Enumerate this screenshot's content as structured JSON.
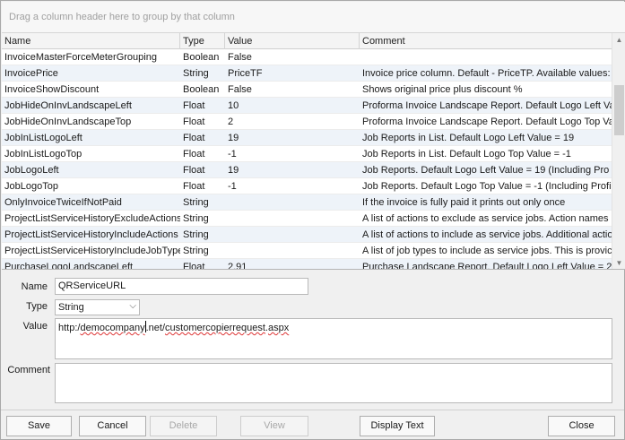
{
  "group_panel": {
    "hint": "Drag a column header here to group by that column"
  },
  "grid": {
    "columns": [
      "Name",
      "Type",
      "Value",
      "Comment"
    ],
    "rows": [
      {
        "name": "InvoiceMasterForceMeterGrouping",
        "type": "Boolean",
        "value": "False",
        "comment": ""
      },
      {
        "name": "InvoicePrice",
        "type": "String",
        "value": "PriceTF",
        "comment": "Invoice price column. Default - PriceTP. Available values:"
      },
      {
        "name": "InvoiceShowDiscount",
        "type": "Boolean",
        "value": "False",
        "comment": "Shows original price plus discount %"
      },
      {
        "name": "JobHideOnInvLandscapeLeft",
        "type": "Float",
        "value": "10",
        "comment": "Proforma Invoice Landscape Report. Default Logo Left Va"
      },
      {
        "name": "JobHideOnInvLandscapeTop",
        "type": "Float",
        "value": "2",
        "comment": "Proforma Invoice Landscape Report. Default Logo Top Va"
      },
      {
        "name": "JobInListLogoLeft",
        "type": "Float",
        "value": "19",
        "comment": "Job Reports in List. Default Logo Left Value = 19"
      },
      {
        "name": "JobInListLogoTop",
        "type": "Float",
        "value": "-1",
        "comment": "Job Reports in List. Default Logo Top Value = -1"
      },
      {
        "name": "JobLogoLeft",
        "type": "Float",
        "value": "19",
        "comment": "Job Reports. Default Logo Left Value = 19 (Including Pro"
      },
      {
        "name": "JobLogoTop",
        "type": "Float",
        "value": "-1",
        "comment": "Job Reports. Default Logo Top Value = -1 (Including Profi"
      },
      {
        "name": "OnlyInvoiceTwiceIfNotPaid",
        "type": "String",
        "value": "",
        "comment": "If the invoice is fully paid it prints out only once"
      },
      {
        "name": "ProjectListServiceHistoryExcludeActions",
        "type": "String",
        "value": "",
        "comment": "A list of actions to exclude as service jobs. Action names"
      },
      {
        "name": "ProjectListServiceHistoryIncludeActions",
        "type": "String",
        "value": "",
        "comment": "A list of actions to include as service jobs. Additional actio"
      },
      {
        "name": "ProjectListServiceHistoryIncludeJobType",
        "type": "String",
        "value": "",
        "comment": "A list of job types to include as service jobs. This is provic"
      },
      {
        "name": "PurchaseLogoLandscapeLeft",
        "type": "Float",
        "value": "2.91",
        "comment": "Purchase Landscape Report. Default Logo Left Value = 2"
      }
    ]
  },
  "form": {
    "name_label": "Name",
    "name_value": "QRServiceURL",
    "type_label": "Type",
    "type_value": "String",
    "value_label": "Value",
    "value_part1": "http:/",
    "value_part2": "democompany",
    "value_part3": ".net/",
    "value_part4": "customercopierrequest",
    "value_part5": ".",
    "value_part6": "aspx",
    "comment_label": "Comment",
    "comment_value": ""
  },
  "buttons": {
    "save": "Save",
    "cancel": "Cancel",
    "delete": "Delete",
    "view": "View",
    "display_text": "Display Text",
    "close": "Close"
  }
}
